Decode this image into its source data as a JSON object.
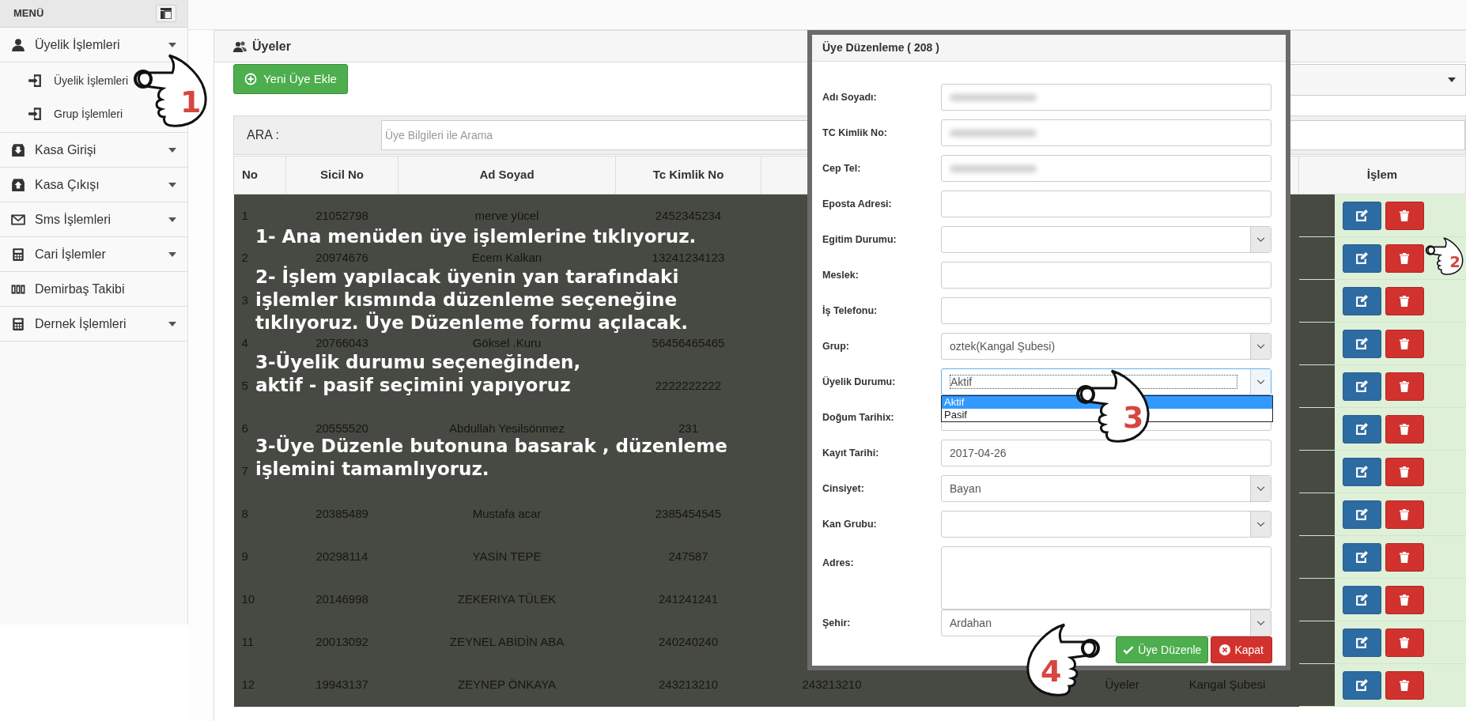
{
  "sidebar": {
    "title": "MENÜ",
    "items": [
      {
        "label": "Üyelik İşlemleri",
        "has_submenu": true,
        "expanded": true,
        "children": [
          {
            "label": "Üyelik İşlemleri"
          },
          {
            "label": "Grup İşlemleri"
          }
        ]
      },
      {
        "label": "Kasa Girişi",
        "has_submenu": true,
        "expanded": false
      },
      {
        "label": "Kasa Çıkışı",
        "has_submenu": true,
        "expanded": false
      },
      {
        "label": "Sms İşlemleri",
        "has_submenu": true,
        "expanded": false
      },
      {
        "label": "Cari İşlemler",
        "has_submenu": true,
        "expanded": false
      },
      {
        "label": "Demirbaş Takibi",
        "has_submenu": false
      },
      {
        "label": "Dernek İşlemleri",
        "has_submenu": true,
        "expanded": false
      }
    ]
  },
  "panel": {
    "title": "Üyeler",
    "add_button": "Yeni Üye Ekle",
    "search": {
      "label": "ARA :",
      "placeholder": "Üye Bilgileri ile Arama"
    }
  },
  "table": {
    "columns": [
      {
        "label": "No"
      },
      {
        "label": "Sicil No"
      },
      {
        "label": "Ad Soyad"
      },
      {
        "label": "Tc Kimlik No"
      },
      {
        "label": "İşlem"
      }
    ],
    "rows": [
      {
        "no": "1",
        "sicil_no": "21052798",
        "ad_soyad": "merve yücel",
        "tc_kimlik_no": "2452345234"
      },
      {
        "no": "2",
        "sicil_no": "20974676",
        "ad_soyad": "Ecem Kalkan",
        "tc_kimlik_no": "13241234123"
      },
      {
        "no": "3"
      },
      {
        "no": "4",
        "sicil_no": "20766043",
        "ad_soyad": "Göksel .Kuru",
        "tc_kimlik_no": "56456465465"
      },
      {
        "no": "5",
        "tc_kimlik_no": "2222222222"
      },
      {
        "no": "6",
        "sicil_no": "20555520",
        "ad_soyad": "Abdullah Yesilsönmez",
        "tc_kimlik_no": "231"
      },
      {
        "no": "7"
      },
      {
        "no": "8",
        "sicil_no": "20385489",
        "ad_soyad": "Mustafa acar",
        "tc_kimlik_no": "2385454545"
      },
      {
        "no": "9",
        "sicil_no": "20298114",
        "ad_soyad": "YASİN TEPE",
        "tc_kimlik_no": "247587"
      },
      {
        "no": "10",
        "sicil_no": "20146998",
        "ad_soyad": "ZEKERIYA TÜLEK",
        "tc_kimlik_no": "241241241"
      },
      {
        "no": "11",
        "sicil_no": "20013092",
        "ad_soyad": "ZEYNEL ABİDİN ABA",
        "tc_kimlik_no": "240240240"
      },
      {
        "no": "12",
        "sicil_no": "19943137",
        "ad_soyad": "ZEYNEP ÖNKAYA",
        "tc_kimlik_no": "243213210",
        "column_5": "243213210",
        "column_7": "Üyeler",
        "column_8": "Kangal Şubesi"
      }
    ]
  },
  "annotations": [
    {
      "lines": [
        "1- Ana menüden üye işlemlerine tıklıyoruz."
      ]
    },
    {
      "lines": [
        "2- İşlem yapılacak üyenin yan tarafındaki",
        "işlemler kısmında düzenleme seçeneğine",
        "tıklıyoruz. Üye Düzenleme formu açılacak."
      ]
    },
    {
      "lines": [
        "3-Üyelik durumu seçeneğinden,",
        "aktif - pasif seçimini yapıyoruz"
      ]
    },
    {
      "lines": [
        "3-Üye Düzenle butonuna basarak , düzenleme",
        "işlemini tamamlıyoruz."
      ]
    }
  ],
  "modal": {
    "title": "Üye Düzenleme ( 208 )",
    "fields": [
      {
        "label": "Adı Soyadı:",
        "kind": "text",
        "redacted": true
      },
      {
        "label": "TC Kimlik No:",
        "kind": "text",
        "redacted": true
      },
      {
        "label": "Cep Tel:",
        "kind": "text",
        "redacted": true
      },
      {
        "label": "Eposta Adresi:",
        "kind": "text",
        "redacted": false
      },
      {
        "label": "Egitim Durumu:",
        "kind": "select",
        "redacted": false
      },
      {
        "label": "Meslek:",
        "kind": "text",
        "redacted": false
      },
      {
        "label": "İş Telefonu:",
        "kind": "text",
        "redacted": false
      },
      {
        "label": "Grup:",
        "kind": "select",
        "redacted": false,
        "value": "oztek(Kangal Şubesi)"
      },
      {
        "label": "Üyelik Durumu:",
        "kind": "select",
        "redacted": false,
        "value": "Aktif",
        "open": true,
        "options": [
          {
            "label": "Aktif",
            "selected": true
          },
          {
            "label": "Pasif",
            "selected": false
          }
        ]
      },
      {
        "label": "Doğum Tarihix:",
        "kind": "text",
        "redacted": false
      },
      {
        "label": "Kayıt Tarihi:",
        "kind": "text",
        "redacted": false,
        "value": "2017-04-26"
      },
      {
        "label": "Cinsiyet:",
        "kind": "select",
        "redacted": false,
        "value": "Bayan"
      },
      {
        "label": "Kan Grubu:",
        "kind": "select",
        "redacted": false
      },
      {
        "label": "Adres:",
        "kind": "textarea",
        "redacted": false
      },
      {
        "label": "Şehir:",
        "kind": "select",
        "redacted": false,
        "value": "Ardahan"
      }
    ],
    "buttons": [
      {
        "label": "Üye Düzenle",
        "kind": "primary"
      },
      {
        "label": "Kapat",
        "kind": "close"
      }
    ]
  },
  "pointers": [
    {
      "number": "1"
    },
    {
      "number": "2"
    },
    {
      "number": "3"
    },
    {
      "number": "4"
    }
  ]
}
